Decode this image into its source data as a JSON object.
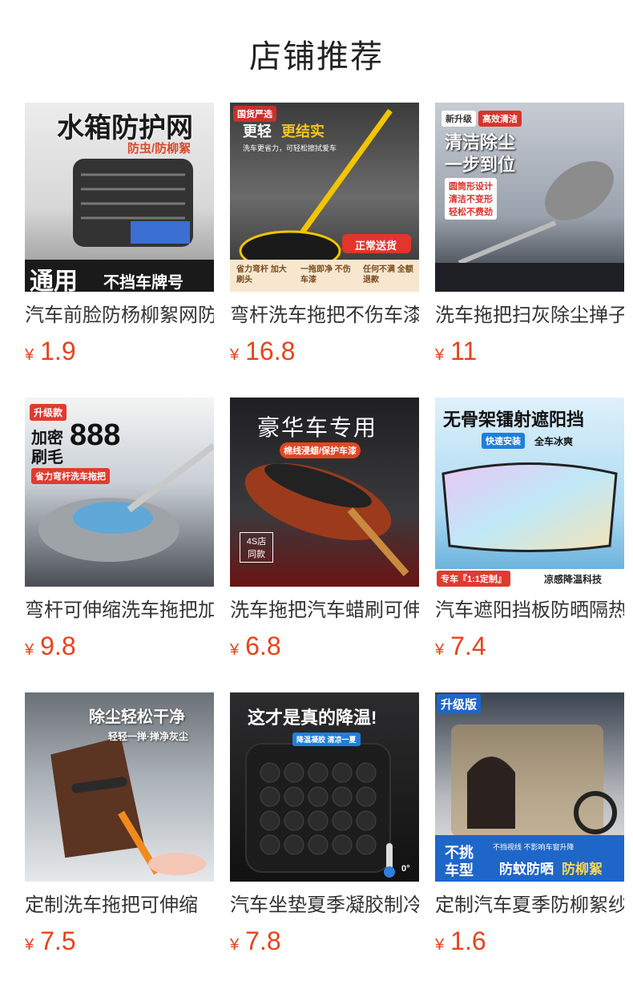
{
  "section_title": "店铺推荐",
  "currency": "¥",
  "products": [
    {
      "name": "汽车前脸防杨柳絮网防",
      "price": "1.9",
      "image_texts": [
        "水箱防护网",
        "防虫/防柳絮",
        "通用",
        "不挡车牌号"
      ]
    },
    {
      "name": "弯杆洗车拖把不伤车漆",
      "price": "16.8",
      "image_texts": [
        "国货严选",
        "更轻",
        "更结实",
        "洗车更省力，可轻松擦拭爱车",
        "正常送货",
        "省力弯杆 加大刷头",
        "一拖即净 不伤车漆",
        "任何不满 全额退款"
      ]
    },
    {
      "name": "洗车拖把扫灰除尘掸子",
      "price": "11",
      "image_texts": [
        "新升级",
        "高效清洁",
        "清洁除尘",
        "一步到位",
        "圆筒形设计",
        "清洁不变形",
        "轻松不费劲"
      ]
    },
    {
      "name": "弯杆可伸缩洗车拖把加",
      "price": "9.8",
      "image_texts": [
        "升级款",
        "加密",
        "刷毛",
        "888",
        "省力弯杆洗车拖把"
      ]
    },
    {
      "name": "洗车拖把汽车蜡刷可伸",
      "price": "6.8",
      "image_texts": [
        "豪华车专用",
        "棉线浸蜡/保护车漆",
        "4S店 同款"
      ]
    },
    {
      "name": "汽车遮阳挡板防晒隔热",
      "price": "7.4",
      "image_texts": [
        "无骨架镭射遮阳挡",
        "快速安装",
        "全车冰爽",
        "专车『1:1定制』",
        "凉感降温科技"
      ]
    },
    {
      "name": "定制洗车拖把可伸缩",
      "price": "7.5",
      "image_texts": [
        "除尘轻松干净",
        "轻轻一掸·掸净灰尘"
      ]
    },
    {
      "name": "汽车坐垫夏季凝胶制冷",
      "price": "7.8",
      "image_texts": [
        "这才是真的降温!",
        "降温凝胶 清凉一夏",
        "0°"
      ]
    },
    {
      "name": "定制汽车夏季防柳絮纱",
      "price": "1.6",
      "image_texts": [
        "升级版",
        "不挑",
        "车型",
        "不挡视线 不影响车窗升降",
        "防蚊防晒",
        "防柳絮"
      ]
    }
  ],
  "colors": {
    "price": "#e8431b",
    "title": "#222222",
    "product_name": "#333333"
  }
}
